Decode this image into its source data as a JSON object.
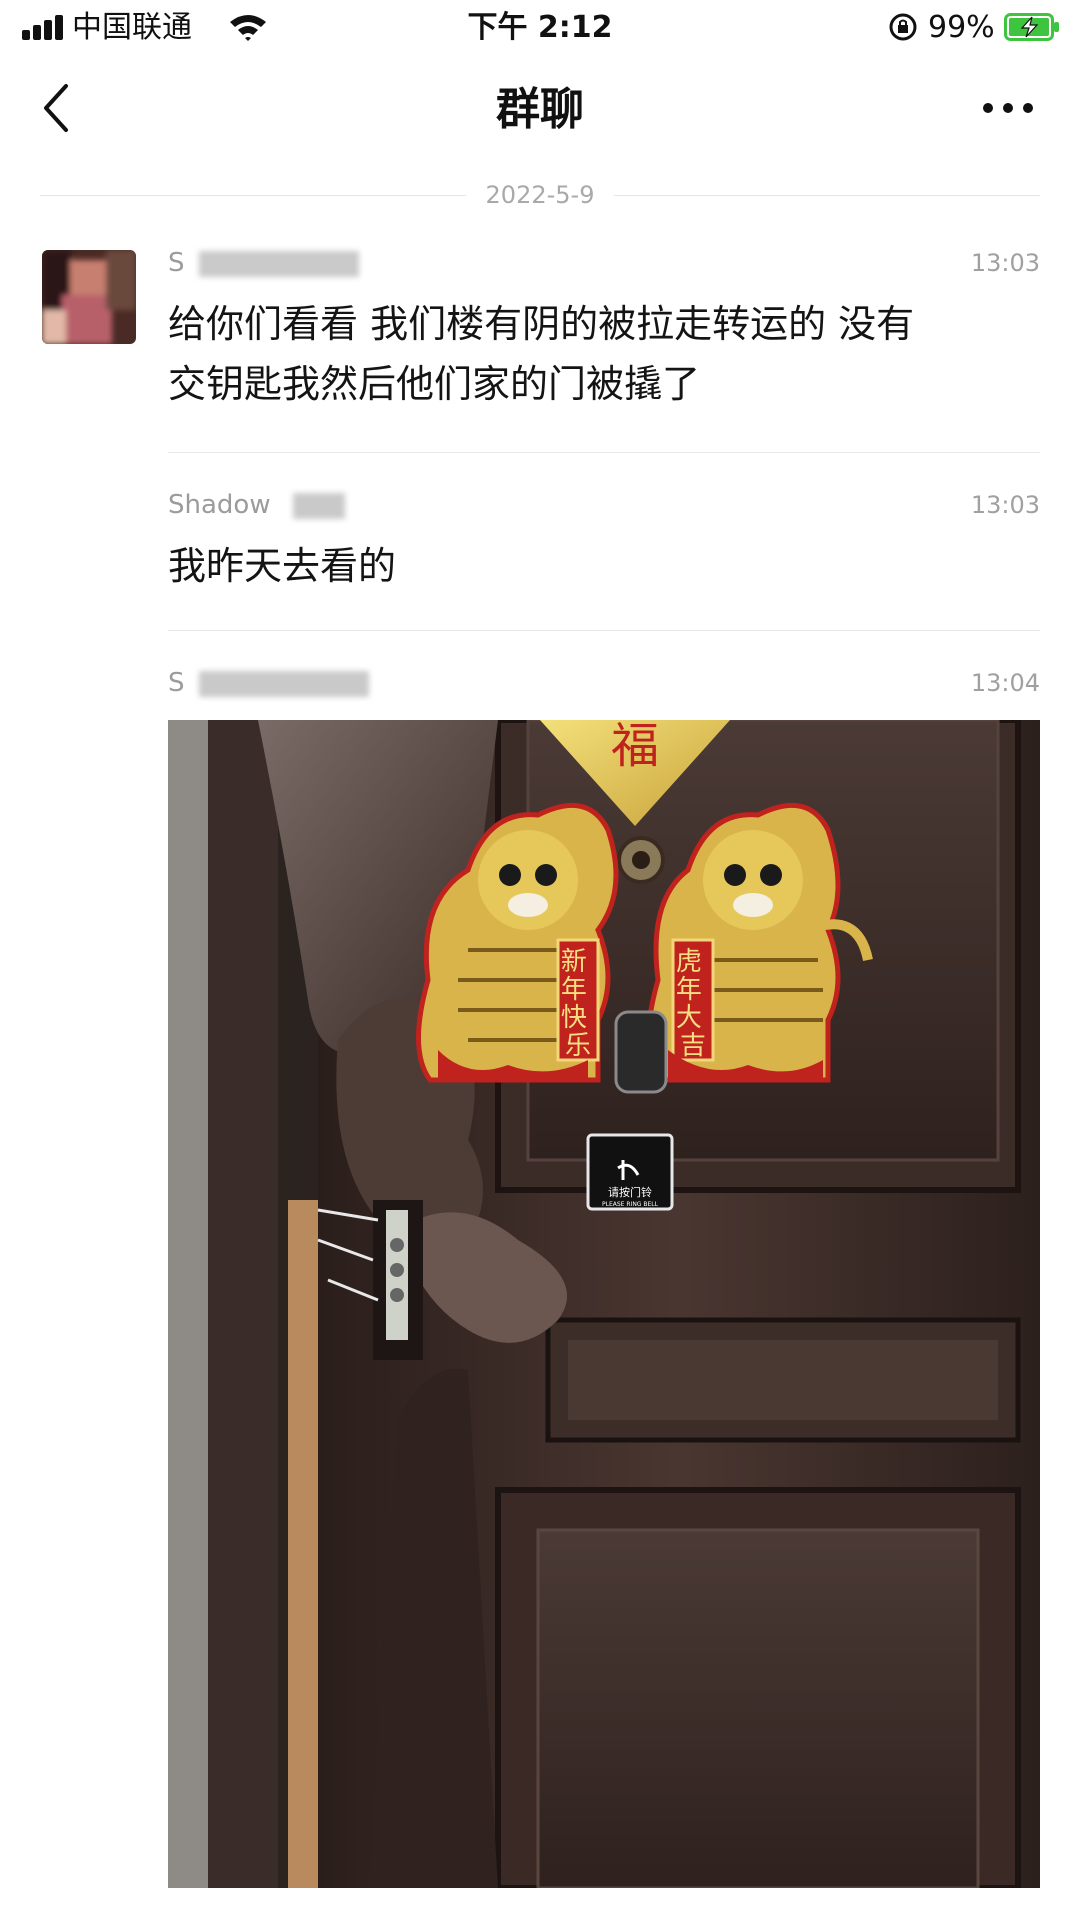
{
  "status_bar": {
    "carrier": "中国联通",
    "time": "下午 2:12",
    "battery": "99%"
  },
  "nav": {
    "title": "群聊",
    "back_icon": "chevron-left-icon",
    "more_icon": "ellipsis-icon"
  },
  "date_divider": "2022-5-9",
  "messages": [
    {
      "sender": "S",
      "time": "13:03",
      "text_lines": [
        "给你们看看 我们楼有阴的被拉走转运的 没有",
        "交钥匙我然后他们家的门被撬了"
      ]
    },
    {
      "sender": "Shadow",
      "time": "13:03",
      "text": "我昨天去看的"
    },
    {
      "sender": "S",
      "time": "13:04",
      "image": {
        "plaque_char": "福",
        "couplet_left": "新年快乐",
        "couplet_right": "虎年大吉",
        "doorbell_label": "请按门铃",
        "doorbell_label_en": "PLEASE RING BELL"
      }
    }
  ],
  "colors": {
    "background": "#ffffff",
    "text": "#141414",
    "meta": "#a0a0a0",
    "divider": "#e8e8e8",
    "battery_green": "#3fc43f"
  }
}
